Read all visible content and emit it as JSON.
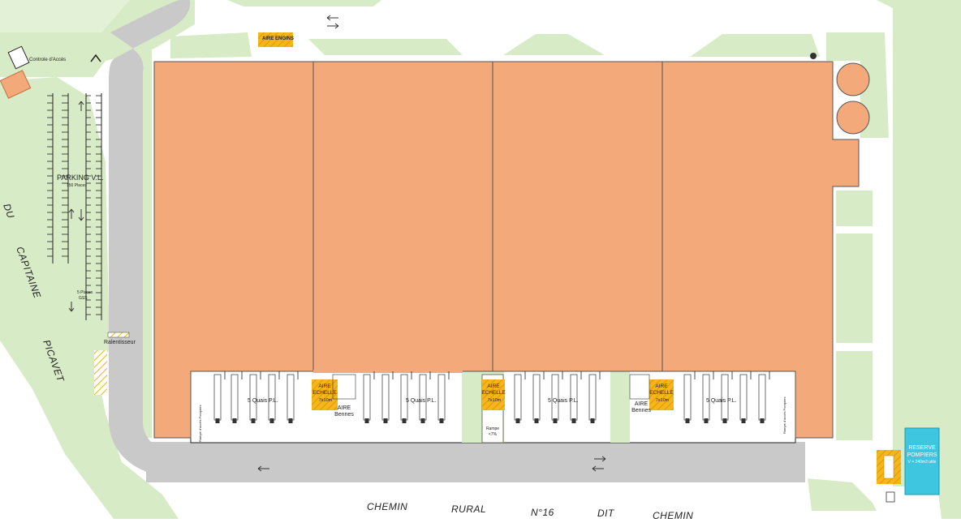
{
  "labels": {
    "aire_engins": "AIRE ENGINS",
    "controle_acces": "Controle d'Accès",
    "parking_title": "PARKING V.L.",
    "parking_places": "150 Places",
    "parking_small": "5 Places",
    "parking_small_sub": "GSS",
    "valentisseur": "Ralentisseur",
    "aire_echelle": "AIRE",
    "aire_echelle_2": "ECHELLE",
    "aire_echelle_dims": "7x10m",
    "aire_bennes_1": "AIRE",
    "aire_bennes_2": "Bennes",
    "quais": "5 Quais P.L.",
    "rampe": "Rampe",
    "rampe_pct": "<7%",
    "reserve_1": "RESERVE",
    "reserve_2": "POMPIERS",
    "reserve_3": "V = 240m3 utile",
    "rampe_side": "Rampe d'accès Pompiers"
  },
  "road_words_left": [
    "DU",
    "CAPITAINE",
    "PICAVET"
  ],
  "road_words_bottom": [
    "CHEMIN",
    "RURAL",
    "N°16",
    "DIT",
    "CHEMIN"
  ],
  "colors": {
    "building": "#f4a97a",
    "grass": "#d7ecc6",
    "road": "#c8c8c8",
    "marking": "#f5b51c",
    "reserve": "#3ec6e0"
  }
}
